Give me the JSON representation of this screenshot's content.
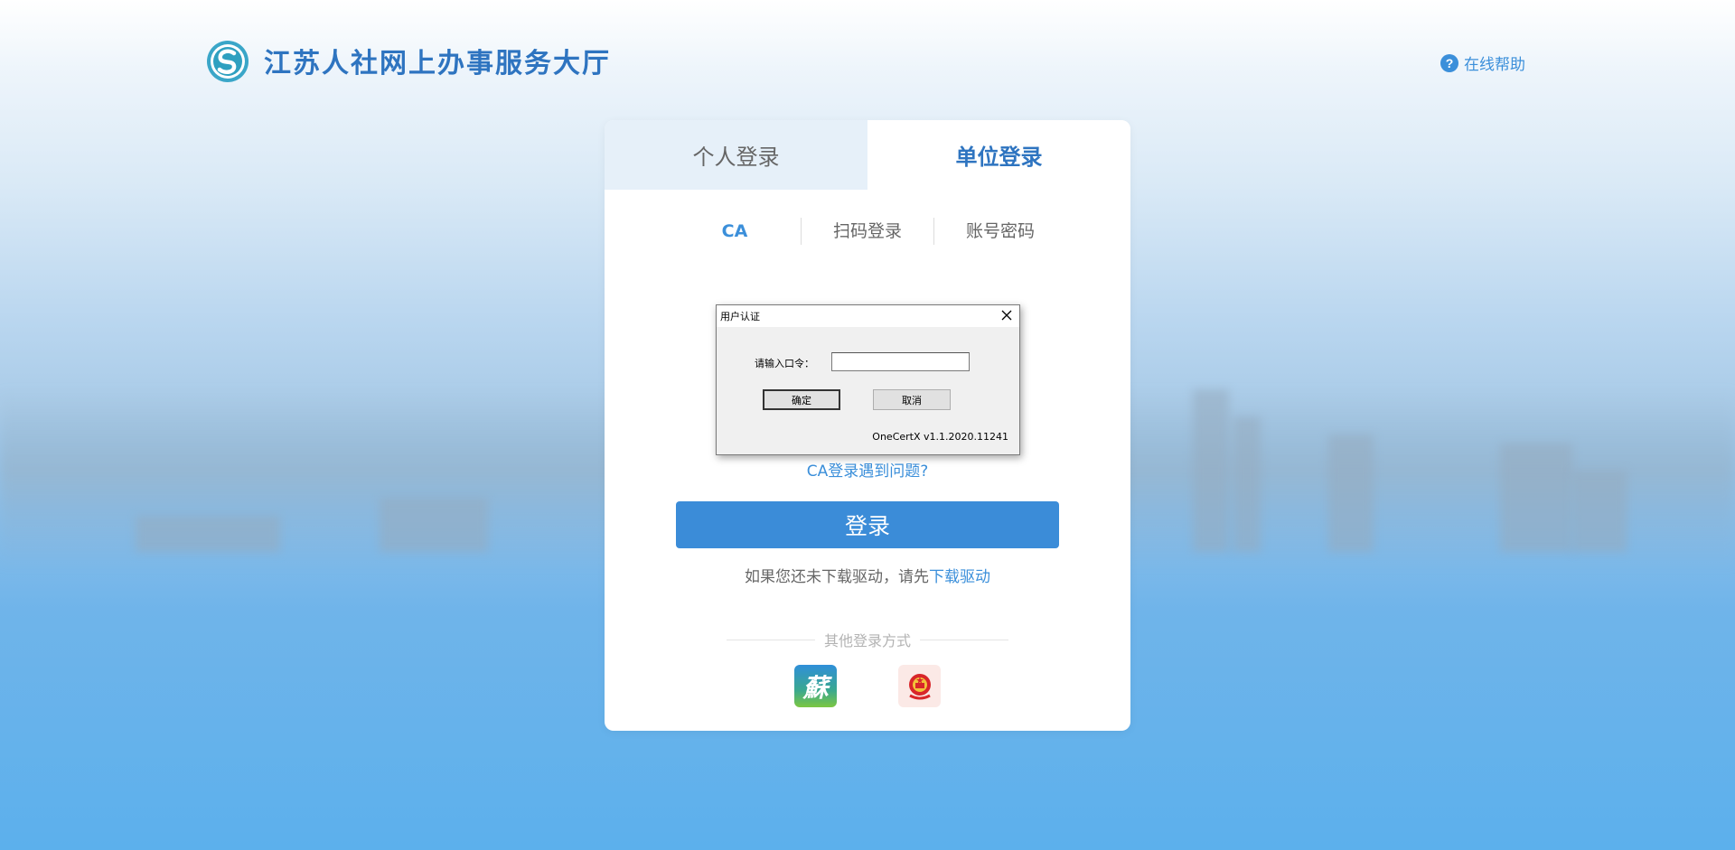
{
  "header": {
    "site_title": "江苏人社网上办事服务大厅",
    "help_label": "在线帮助",
    "help_icon": "?"
  },
  "login": {
    "type_tabs": [
      {
        "label": "个人登录",
        "active": false
      },
      {
        "label": "单位登录",
        "active": true
      }
    ],
    "method_tabs": [
      {
        "label": "CA",
        "active": true
      },
      {
        "label": "扫码登录",
        "active": false
      },
      {
        "label": "账号密码",
        "active": false
      }
    ],
    "ca_problem_link": "CA登录遇到问题?",
    "login_button": "登录",
    "driver_text": "如果您还未下载驱动，请先",
    "driver_link": "下载驱动",
    "other_methods_label": "其他登录方式",
    "alt_methods": [
      {
        "icon": "su-app-icon",
        "glyph": "蘇"
      },
      {
        "icon": "national-emblem-icon"
      }
    ]
  },
  "dialog": {
    "title": "用户认证",
    "password_label": "请输入口令：",
    "password_value": "",
    "ok_button": "确定",
    "cancel_button": "取消",
    "version": "OneCertX v1.1.2020.11241"
  },
  "colors": {
    "accent": "#3b8fda",
    "title_blue": "#2e74c0",
    "login_button": "#3b8cd8"
  }
}
